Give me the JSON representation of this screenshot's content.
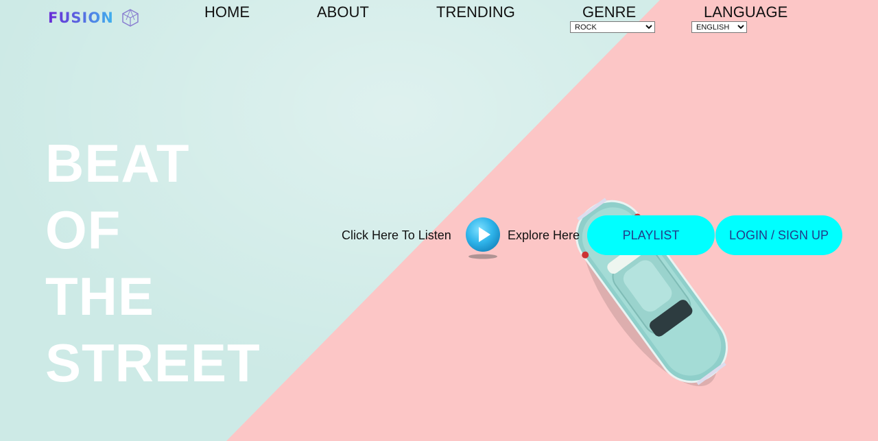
{
  "logo": {
    "text": "FUSION",
    "icon": "hexagon-cube-icon"
  },
  "nav": {
    "home": "HOME",
    "about": "ABOUT",
    "trending": "TRENDING",
    "genre": "GENRE",
    "language": "LANGUAGE"
  },
  "genre_select": {
    "selected": "ROCK"
  },
  "language_select": {
    "selected": "ENGLISH"
  },
  "hero": {
    "lines": [
      "BEAT",
      "OF",
      "THE",
      "STREET"
    ]
  },
  "actions": {
    "listen_text": "Click Here To Listen",
    "play_icon": "play-icon",
    "explore_text": "Explore Here",
    "playlist_label": "PLAYLIST",
    "login_label": "LOGIN / SIGN UP"
  },
  "colors": {
    "background_left": "#cdeae6",
    "background_right": "#fcc6c6",
    "pill_button": "#00ffff",
    "pill_text": "#213b8a",
    "hero_text": "#ffffff"
  }
}
